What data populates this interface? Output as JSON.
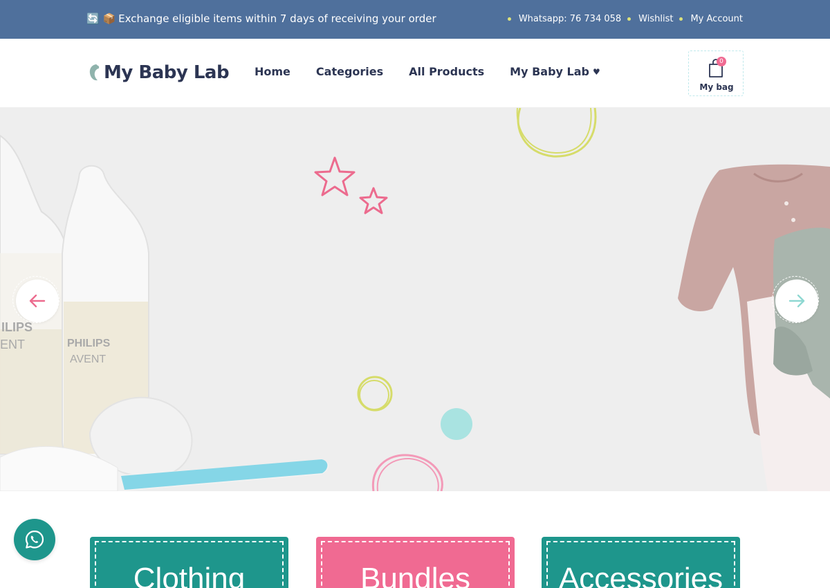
{
  "topbar": {
    "promo_icons": "🔄 📦",
    "promo_text": "Exchange eligible items within 7 days of receiving your order",
    "links": [
      "Whatsapp: 76 734 058",
      "Wishlist",
      "My Account"
    ]
  },
  "header": {
    "logo_text": "My Baby Lab",
    "nav": [
      "Home",
      "Categories",
      "All Products",
      "My Baby Lab"
    ],
    "active_nav": "Home",
    "bag": {
      "count": "0",
      "label": "My bag"
    }
  },
  "hero": {
    "bottle_brand": "PHILIPS",
    "bottle_subbrand": "AVENT",
    "bottle_brand_cropped": "ILIPS",
    "bottle_subbrand_cropped": "ENT"
  },
  "categories": [
    "Clothing",
    "Bundles",
    "Accessories"
  ],
  "colors": {
    "topbar": "#4f709c",
    "navy": "#2c3553",
    "teal": "#1e968c",
    "pink": "#f06a92",
    "hero_bg": "#eeeeee",
    "accent_yellow": "#dde27a",
    "accent_mint": "#a9e3e1"
  },
  "icons": [
    "bag-icon",
    "arrow-left-icon",
    "arrow-right-icon",
    "whatsapp-icon",
    "heart-icon",
    "logo-icon"
  ]
}
